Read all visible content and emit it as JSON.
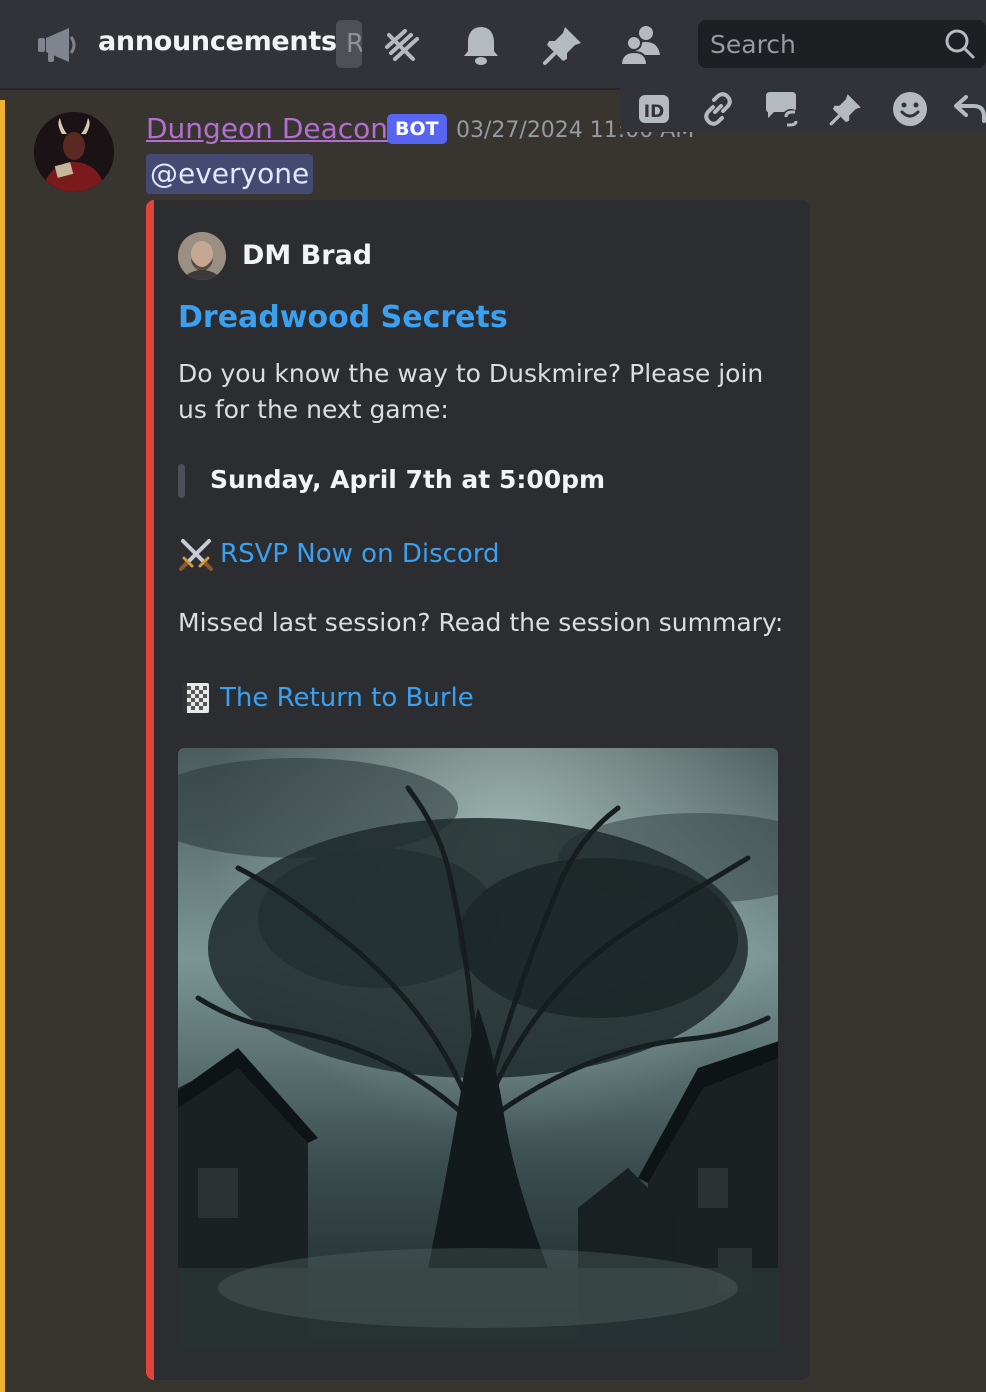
{
  "header": {
    "channel_name": "announcements",
    "topic_preview": "R",
    "search_placeholder": "Search",
    "icons": [
      "megaphone-icon",
      "threads-icon",
      "bell-icon",
      "pin-icon",
      "members-icon",
      "search-icon"
    ]
  },
  "message": {
    "author": "Dungeon Deacon",
    "bot_tag": "BOT",
    "timestamp": "03/27/2024 11:00 AM",
    "mention": "@everyone",
    "hover_actions": [
      "copy-id-icon",
      "copy-link-icon",
      "reply-thread-icon",
      "pin-icon",
      "reaction-icon",
      "reply-icon"
    ],
    "colors": {
      "author": "#b36fd0",
      "mention_bar": "#f0b232",
      "embed_border": "#e2443c",
      "link": "#3ba0f0"
    }
  },
  "embed": {
    "author": "DM Brad",
    "title": "Dreadwood Secrets",
    "description": "Do you know the way to Duskmire? Please join us for the next game:",
    "quote": "Sunday, April 7th at 5:00pm",
    "rsvp_emoji": "crossed-swords-icon",
    "rsvp_link": "RSVP Now on Discord",
    "summary_prompt": "Missed last session? Read the session summary:",
    "summary_emoji": "notebook-icon",
    "summary_link": "The Return to Burle",
    "image": "dark-twisted-tree-over-village-image"
  }
}
